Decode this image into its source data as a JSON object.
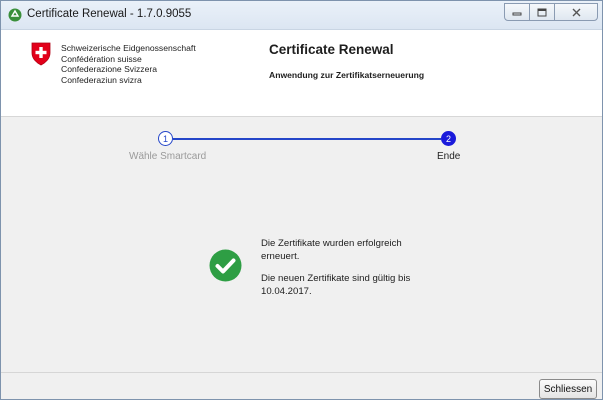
{
  "window": {
    "title": "Certificate Renewal - 1.7.0.9055"
  },
  "header": {
    "confederation_lines": [
      "Schweizerische Eidgenossenschaft",
      "Confédération suisse",
      "Confederazione Svizzera",
      "Confederaziun svizra"
    ],
    "app_title": "Certificate Renewal",
    "app_subtitle": "Anwendung zur Zertifikatserneuerung"
  },
  "steps": [
    {
      "number": "1",
      "label": "Wähle Smartcard",
      "state": "done"
    },
    {
      "number": "2",
      "label": "Ende",
      "state": "active"
    }
  ],
  "result": {
    "message_1": "Die Zertifikate wurden erfolgreich erneuert.",
    "message_2": "Die neuen Zertifikate sind gültig bis 10.04.2017."
  },
  "footer": {
    "close_label": "Schliessen"
  },
  "colors": {
    "accent": "#2546c9",
    "active_step": "#1a1adb",
    "success": "#2e9e44",
    "swiss_red": "#e2001a"
  },
  "icons": {
    "app": "recycle-icon",
    "shield": "swiss-shield-icon",
    "success": "check-circle-icon"
  }
}
